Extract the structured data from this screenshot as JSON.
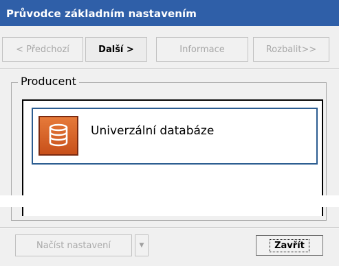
{
  "window": {
    "title": "Průvodce základním nastavením"
  },
  "toolbar": {
    "prev_label": "< Předchozí",
    "next_label": "Další >",
    "info_label": "Informace",
    "expand_label": "Rozbalit>>"
  },
  "group": {
    "title": "Producent",
    "items": [
      {
        "label": "Univerzální databáze",
        "icon": "database-icon",
        "selected": true
      }
    ]
  },
  "footer": {
    "load_label": "Načíst nastavení",
    "dropdown_icon": "chevron-down-icon",
    "close_label": "Zavřít"
  },
  "colors": {
    "titlebar": "#2f5fa8",
    "selection_border": "#2b5c90",
    "icon_orange": "#d35a1e"
  }
}
